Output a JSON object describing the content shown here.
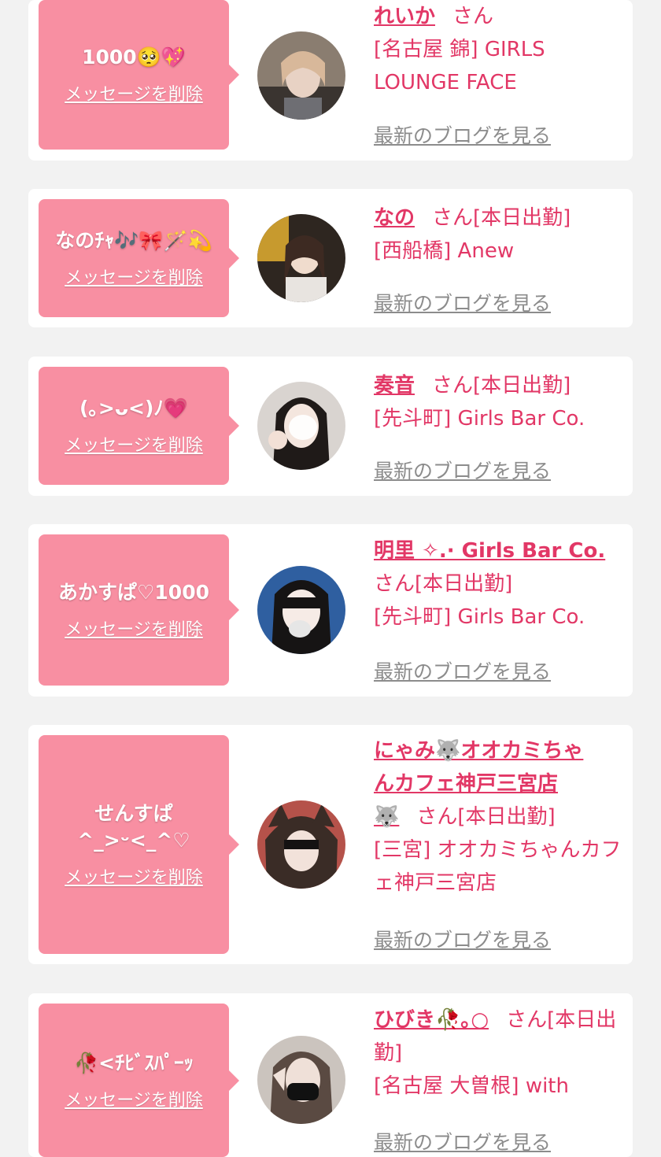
{
  "common": {
    "delete_label": "メッセージを削除",
    "blog_label": "最新のブログを見る",
    "san": "さん",
    "today_badge": "[本日出勤]"
  },
  "colors": {
    "page_bg": "#f2f2f2",
    "bubble_bg": "#f88fa2",
    "name_pink": "#e23766",
    "blog_gray": "#8c8c8c"
  },
  "entries": [
    {
      "message": "1000🥺💖",
      "name": "れいか",
      "shop": "[名古屋 錦] GIRLS LOUNGE FACE"
    },
    {
      "message": "なのﾁｬ🎶🎀🪄💫",
      "name": "なの",
      "shop": "[西船橋] Anew"
    },
    {
      "message": "(｡>ᴗ<)ﾉ💗",
      "name": "奏音",
      "shop": "[先斗町] Girls Bar Co."
    },
    {
      "message": "あかすぱ♡1000",
      "name": "明里 ✧.· Girls Bar Co.",
      "shop": "[先斗町] Girls Bar Co."
    },
    {
      "message": "せんすぱ^_>ᵕ<_^♡",
      "name_line1": "にゃみ🐺オオカミちゃ",
      "name_line2": "んカフェ神戸三宮店",
      "name_line3": "🐺",
      "shop": "[三宮] オオカミちゃんカフェ神戸三宮店"
    },
    {
      "message": "🥀<ﾁﾋﾞｽﾊﾟｰｯ",
      "name": "ひびき🥀｡○",
      "shop": "[名古屋 大曽根] with"
    }
  ]
}
